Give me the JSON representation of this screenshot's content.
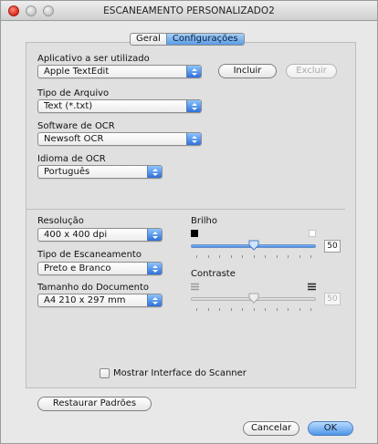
{
  "window": {
    "title": "ESCANEAMENTO PERSONALIZADO2"
  },
  "tabs": [
    {
      "label": "Geral",
      "active": false
    },
    {
      "label": "Configurações",
      "active": true
    }
  ],
  "application": {
    "label": "Aplicativo a ser utilizado",
    "value": "Apple TextEdit",
    "add_button": "Incluir",
    "remove_button": "Excluir"
  },
  "file_type": {
    "label": "Tipo de Arquivo",
    "value": "Text (*.txt)"
  },
  "ocr_software": {
    "label": "Software de OCR",
    "value": "Newsoft OCR"
  },
  "ocr_language": {
    "label": "Idioma de OCR",
    "value": "Português"
  },
  "resolution": {
    "label": "Resolução",
    "value": "400 x 400 dpi"
  },
  "scan_type": {
    "label": "Tipo de Escaneamento",
    "value": "Preto e Branco"
  },
  "document_size": {
    "label": "Tamanho do Documento",
    "value": "A4 210 x 297 mm"
  },
  "brightness": {
    "label": "Brilho",
    "value": "50",
    "level": 0.5,
    "enabled": true
  },
  "contrast": {
    "label": "Contraste",
    "value": "50",
    "level": 0.5,
    "enabled": false
  },
  "show_scanner_interface": {
    "label": "Mostrar Interface do Scanner",
    "checked": false
  },
  "buttons": {
    "restore_defaults": "Restaurar Padrões",
    "cancel": "Cancelar",
    "ok": "OK"
  },
  "colors": {
    "accent": "#4d95e8",
    "close": "#d9261c"
  },
  "icons": [
    "close-icon",
    "minimize-icon",
    "zoom-icon",
    "popup-arrows-icon",
    "sun-dark-icon",
    "sun-light-icon",
    "contrast-low-icon",
    "contrast-high-icon",
    "slider-thumb-icon"
  ]
}
